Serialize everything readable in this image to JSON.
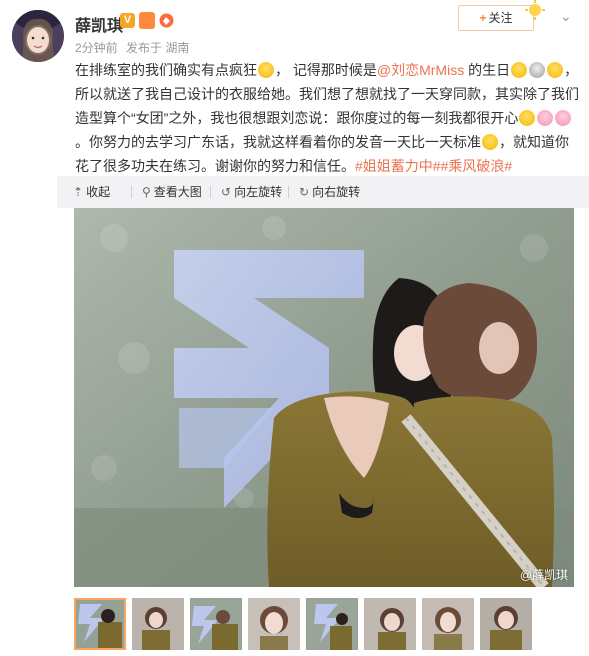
{
  "user": {
    "name": "薛凯琪",
    "verified_badge": "V",
    "time": "2分钟前",
    "source": "发布于 湖南"
  },
  "actions": {
    "follow_label": "关注",
    "follow_plus": "+"
  },
  "post": {
    "t1": "在排练室的我们确实有点疯狂",
    "t2": "， 记得那时候是",
    "mention": "@刘恋MrMiss",
    "t3": " 的生日",
    "t4": "，所以就送了我自己设计的衣服给她。我们想了想就找了一天穿同款，其实除了我们造型算个“女团”之外，我也很想跟刘恋说：跟你度过的每一刻我都很开心",
    "t5": " 。你努力的去学习广东话，我就这样看着你的发音一天比一天标准",
    "t6": "，就知道你花了很多功夫在练习。谢谢你的努力和信任。",
    "hashtags": "#姐姐蓄力中##乘风破浪#"
  },
  "toolbar": {
    "collapse": "收起",
    "view_large": "查看大图",
    "rotate_left": "向左旋转",
    "rotate_right": "向右旋转"
  },
  "image": {
    "watermark": "@薛凯琪"
  },
  "thumbnails": {
    "count": 8,
    "active_index": 0
  },
  "colors": {
    "link": "#eb7350",
    "follow_border": "#f0c9a8",
    "toolbar_bg": "#f2f2f5",
    "active_thumb": "#f7a560"
  }
}
